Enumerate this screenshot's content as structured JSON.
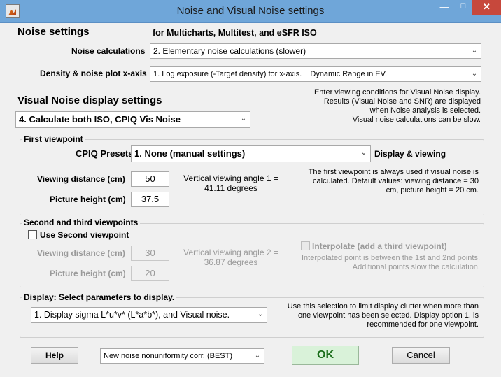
{
  "window": {
    "title": "Noise and Visual Noise settings",
    "minimize": "—",
    "maximize": "□",
    "close": "✕"
  },
  "noise_settings": {
    "heading": "Noise settings",
    "subheading": "for Multicharts, Multitest, and eSFR ISO",
    "calc_label": "Noise calculations",
    "calc_value": "2. Elementary noise calculations (slower)",
    "density_label": "Density & noise plot x-axis",
    "density_value": "1. Log exposure (-Target density) for x-axis.    Dynamic Range in EV."
  },
  "visual_noise": {
    "heading": "Visual Noise display settings",
    "mode_value": "4.  Calculate both ISO, CPIQ Vis Noise",
    "info": [
      "Enter viewing conditions for Visual Noise display.",
      "Results (Visual Noise and SNR) are displayed",
      "when Noise analysis is selected.",
      "Visual noise calculations can be slow."
    ]
  },
  "first_viewpoint": {
    "title": "First viewpoint",
    "presets_label": "CPIQ Presets",
    "presets_value": "1. None (manual settings)",
    "display_viewing": "Display & viewing",
    "distance_label": "Viewing distance (cm)",
    "distance_value": "50",
    "height_label": "Picture height (cm)",
    "height_value": "37.5",
    "angle_line1": "Vertical viewing angle 1 =",
    "angle_line2": "41.11 degrees",
    "note": [
      "The first viewpoint is always used if visual noise is",
      "calculated. Default values: viewing distance = 30",
      "cm,  picture height = 20 cm."
    ]
  },
  "second_viewpoint": {
    "title": "Second and third viewpoints",
    "use_label": "Use Second viewpoint",
    "distance_label": "Viewing distance (cm)",
    "distance_value": "30",
    "height_label": "Picture height (cm)",
    "height_value": "20",
    "angle_line1": "Vertical viewing angle 2 =",
    "angle_line2": "36.87 degrees",
    "interp_label": "Interpolate (add a third viewpoint)",
    "interp_note": [
      "Interpolated point is between the 1st and 2nd points.",
      "Additional points slow the calculation."
    ]
  },
  "display": {
    "title": "Display:  Select parameters to display.",
    "value": "1.  Display sigma L*u*v* (L*a*b*), and Visual noise.",
    "note": [
      "Use this selection to limit display clutter when more than",
      "one viewpoint has been selected. Display option 1. is",
      "recommended for one viewpoint."
    ]
  },
  "footer": {
    "help": "Help",
    "nonuniformity_value": "New noise nonuniformity corr. (BEST)",
    "ok": "OK",
    "cancel": "Cancel"
  },
  "colors": {
    "titlebar": "#6fa6d9",
    "close": "#c7483c",
    "ok_bg": "#d9f2d9",
    "ok_text": "#1b6e1b"
  }
}
